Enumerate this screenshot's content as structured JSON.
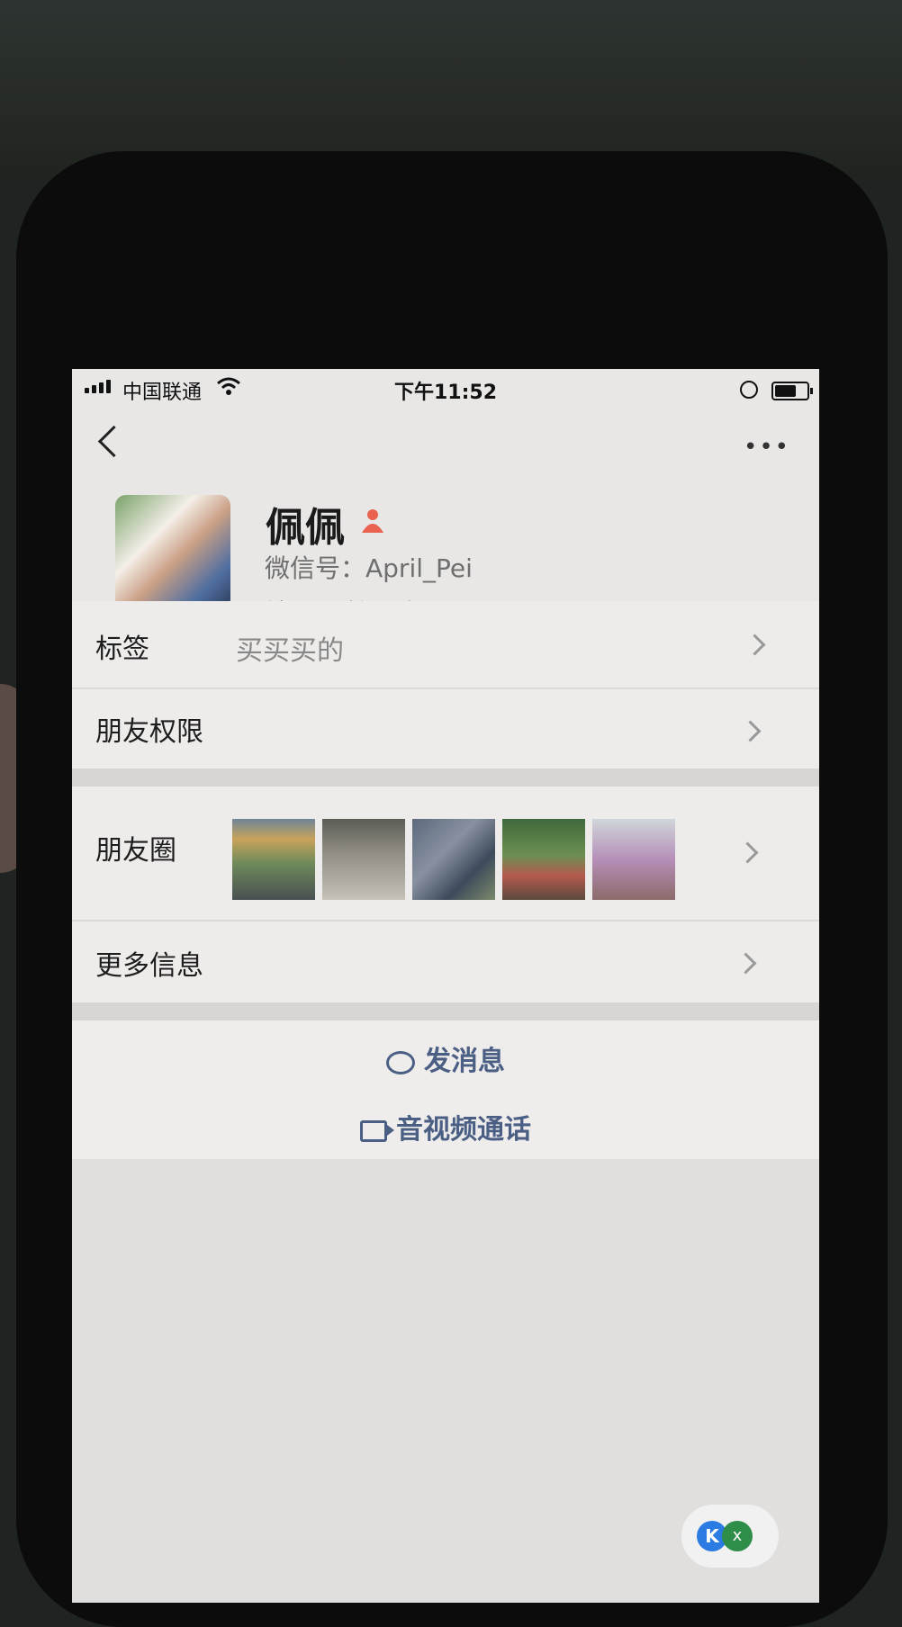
{
  "status_bar": {
    "carrier": "中国联通",
    "time": "下午11:52"
  },
  "profile": {
    "name": "佩佩",
    "wechat_id": "微信号：April_Pei",
    "region": "地区：浙江 台州",
    "gender": "female"
  },
  "rows": {
    "tags_label": "标签",
    "tags_value": "买买买的",
    "permissions_label": "朋友权限",
    "moments_label": "朋友圈",
    "more_info_label": "更多信息"
  },
  "actions": {
    "send_message": "发消息",
    "video_call": "音视频通话"
  },
  "colors": {
    "accent": "#4b5f84",
    "gender_female": "#e8624f"
  },
  "icons": [
    "back-icon",
    "more-icon",
    "chat-icon",
    "video-icon",
    "chevron-right-icon",
    "female-icon"
  ]
}
